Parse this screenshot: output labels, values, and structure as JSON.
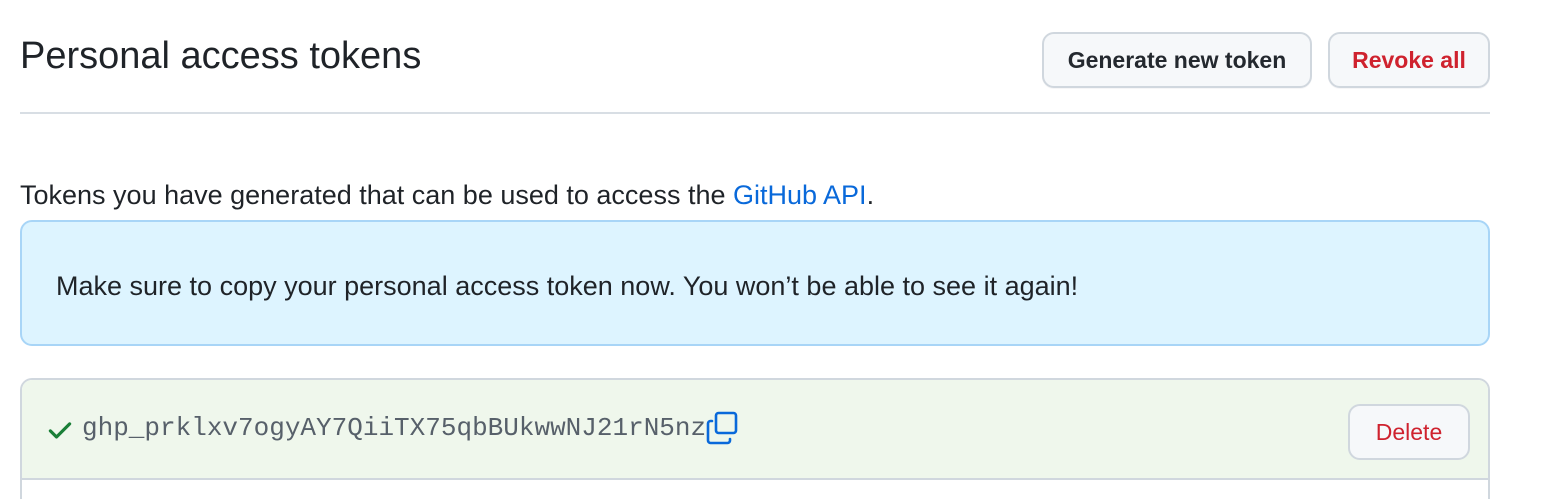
{
  "header": {
    "title": "Personal access tokens",
    "generate_label": "Generate new token",
    "revoke_label": "Revoke all"
  },
  "intro": {
    "text_before": "Tokens you have generated that can be used to access the ",
    "link_label": "GitHub API",
    "text_after": "."
  },
  "flash": {
    "message": "Make sure to copy your personal access token now. You won’t be able to see it again!"
  },
  "token": {
    "value": "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",
    "status_icon": "check-icon",
    "copy_icon": "copy-icon",
    "delete_label": "Delete"
  },
  "colors": {
    "danger": "#cf222e",
    "link": "#0969da",
    "success": "#1a7f37",
    "flash_bg": "#ddf4ff",
    "token_bg": "#eff7ec"
  }
}
